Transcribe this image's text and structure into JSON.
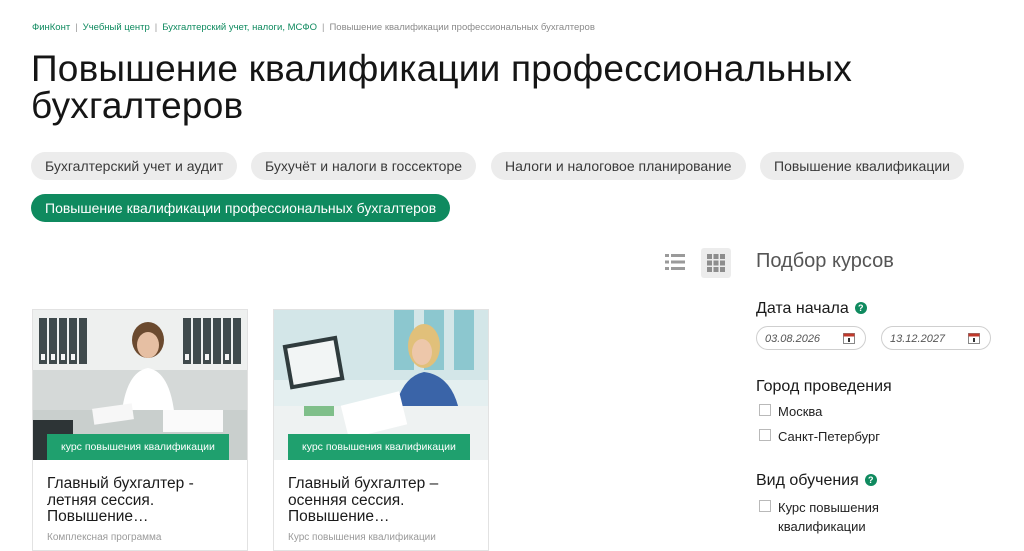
{
  "breadcrumb": {
    "items": [
      "ФинКонт",
      "Учебный центр",
      "Бухгалтерский учет, налоги, МСФО"
    ],
    "current": "Повышение квалификации профессиональных бухгалтеров",
    "separator": "|"
  },
  "page": {
    "title": "Повышение квалификации профессиональных бухгалтеров"
  },
  "tags": [
    {
      "label": "Бухгалтерский учет и аудит",
      "active": false
    },
    {
      "label": "Бухучёт и налоги в госсекторе",
      "active": false
    },
    {
      "label": "Налоги и налоговое планирование",
      "active": false
    },
    {
      "label": "Повышение квалификации",
      "active": false
    },
    {
      "label": "Повышение квалификации профессиональных бухгалтеров",
      "active": true
    }
  ],
  "view_toggle": {
    "list_icon": "list-icon",
    "grid_icon": "grid-icon",
    "selected": "grid"
  },
  "courses": [
    {
      "badge": "курс повышения квалификации",
      "title": "Главный бухгалтер - летняя сессия. Повышение…",
      "description": "Комплексная программа"
    },
    {
      "badge": "курс повышения квалификации",
      "title": "Главный бухгалтер – осенняя сессия. Повышение…",
      "description": "Курс повышения квалификации"
    }
  ],
  "filter": {
    "title": "Подбор курсов",
    "date": {
      "label": "Дата начала",
      "from": "03.08.2026",
      "to": "13.12.2027"
    },
    "city": {
      "label": "Город проведения",
      "options": [
        "Москва",
        "Санкт-Петербург"
      ]
    },
    "type": {
      "label": "Вид обучения",
      "options": [
        "Курс повышения квалификации"
      ]
    }
  },
  "colors": {
    "accent": "#0f8a5f",
    "badge": "#1fa06e",
    "tag_bg": "#ececec"
  }
}
